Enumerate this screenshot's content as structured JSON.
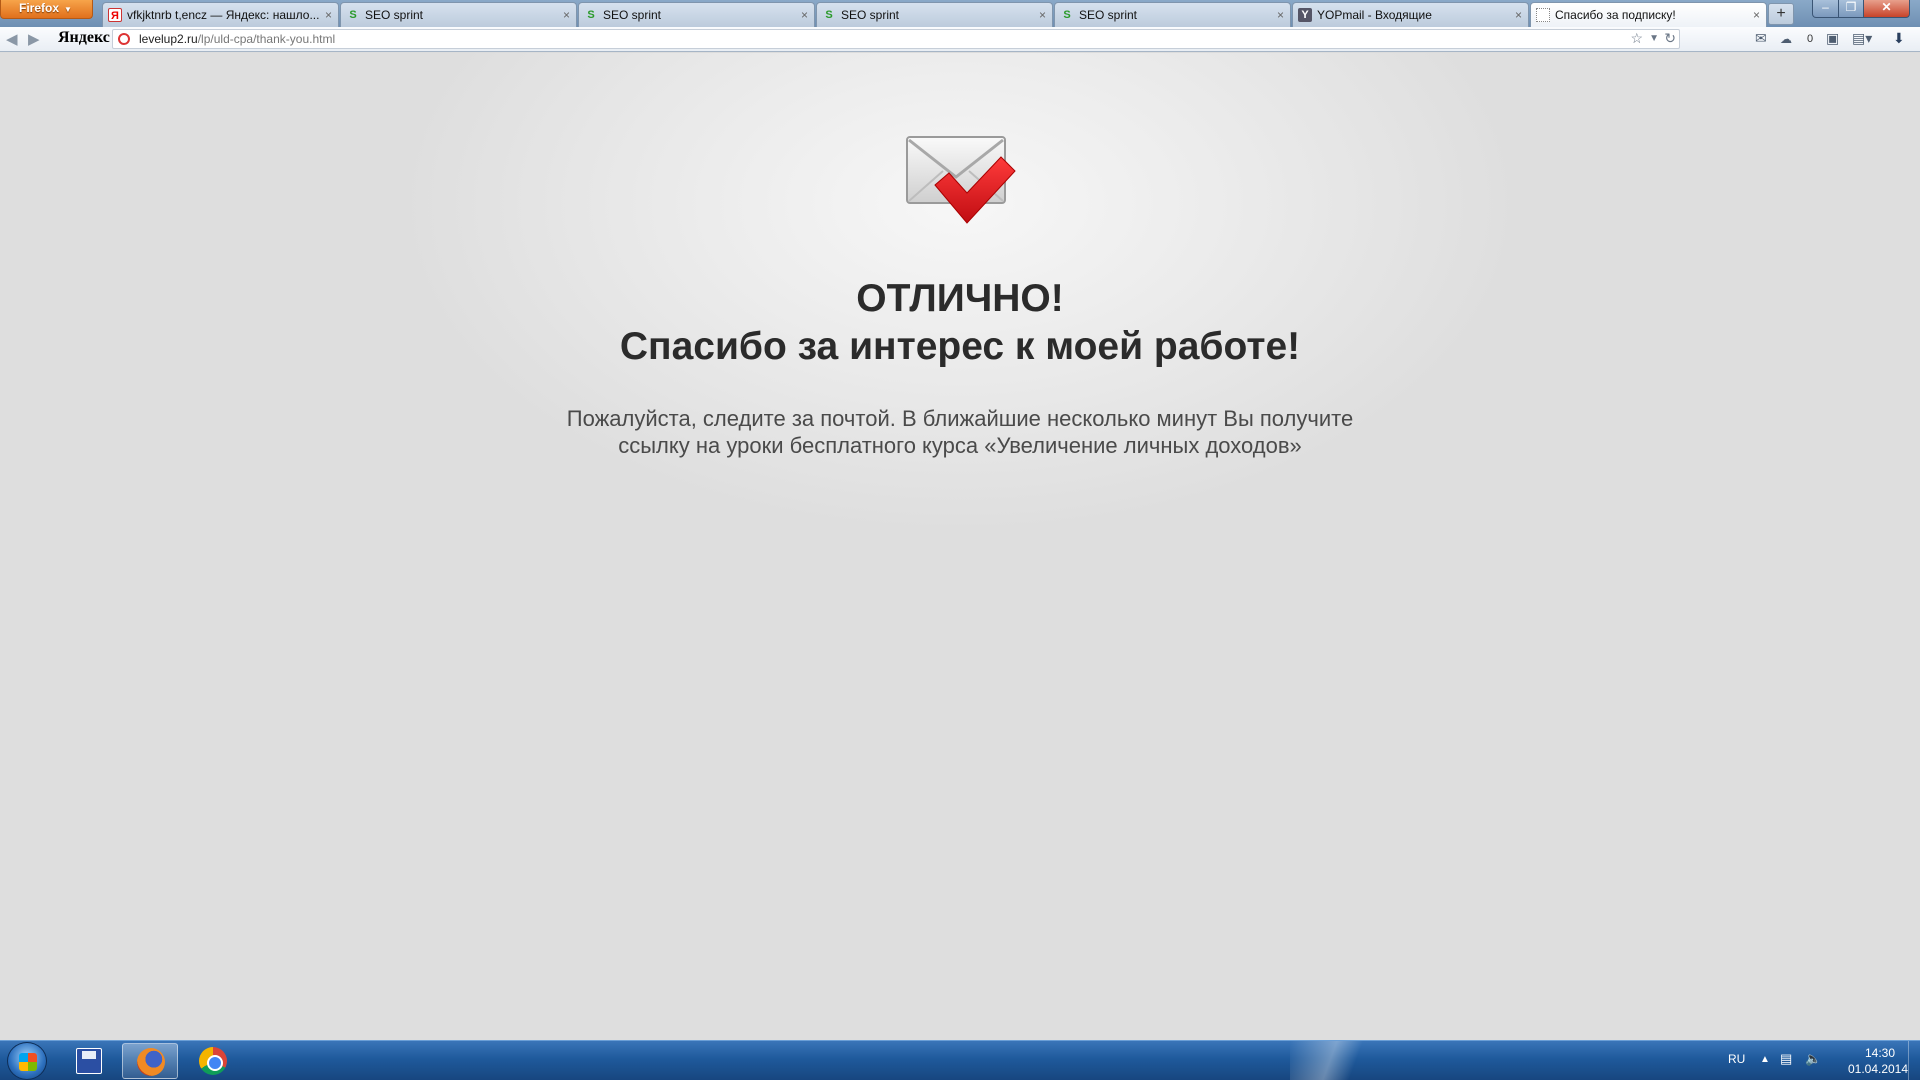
{
  "browser": {
    "menu_label": "Firefox",
    "tabs": [
      {
        "title": "vfkjktnrb t,encz — Яндекс: нашло...",
        "favicon": "yandex-icon",
        "active": false
      },
      {
        "title": "SEO sprint",
        "favicon": "seosprint-icon",
        "active": false
      },
      {
        "title": "SEO sprint",
        "favicon": "seosprint-icon",
        "active": false
      },
      {
        "title": "SEO sprint",
        "favicon": "seosprint-icon",
        "active": false
      },
      {
        "title": "SEO sprint",
        "favicon": "seosprint-icon",
        "active": false
      },
      {
        "title": "YOPmail - Входящие",
        "favicon": "yopmail-icon",
        "active": false
      },
      {
        "title": "Спасибо за подписку!",
        "favicon": "blank-page-icon",
        "active": true
      }
    ],
    "new_tab_label": "+",
    "yandex_logo": "Яндекс",
    "url_domain": "levelup2.ru",
    "url_path": "/lp/uld-cpa/thank-you.html",
    "weather_temp": "0"
  },
  "page": {
    "headline": "ОТЛИЧНО!",
    "subline": "Спасибо за интерес к моей работе!",
    "message_line1": "Пожалуйста, следите за почтой. В ближайшие несколько минут Вы получите",
    "message_line2": "ссылку на уроки бесплатного курса «Увеличение личных доходов»",
    "accent_color": "#e0191f"
  },
  "taskbar": {
    "apps": [
      "save-icon",
      "firefox-icon",
      "chrome-icon"
    ],
    "language": "RU",
    "time": "14:30",
    "date": "01.04.2014"
  }
}
